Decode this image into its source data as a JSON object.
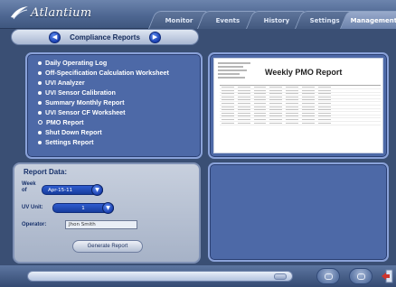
{
  "app": {
    "logo_text": "Atlantium"
  },
  "tabs": [
    {
      "label": "Monitor",
      "active": false
    },
    {
      "label": "Events",
      "active": false
    },
    {
      "label": "History",
      "active": false
    },
    {
      "label": "Settings",
      "active": false
    },
    {
      "label": "Management",
      "active": true
    }
  ],
  "compliance": {
    "title": "Compliance Reports"
  },
  "reports": [
    {
      "label": "Daily Operating Log",
      "selected": false
    },
    {
      "label": "Off-Specification Calculation Worksheet",
      "selected": false
    },
    {
      "label": "UVI Analyzer",
      "selected": false
    },
    {
      "label": "UVI Sensor Calibration",
      "selected": false
    },
    {
      "label": "Summary Monthly Report",
      "selected": false
    },
    {
      "label": "UVI Sensor CF Worksheet",
      "selected": false
    },
    {
      "label": "PMO Report",
      "selected": true
    },
    {
      "label": "Shut Down Report",
      "selected": false
    },
    {
      "label": "Settings Report",
      "selected": false
    }
  ],
  "preview": {
    "title": "Weekly PMO Report"
  },
  "report_data": {
    "title": "Report Data:",
    "week_label": "Week of",
    "week_value": "Apr-15-11",
    "uv_unit_label": "UV Unit:",
    "uv_unit_value": "1",
    "operator_label": "Operator:",
    "operator_value": "Jhon Smith",
    "generate_label": "Generate Report"
  },
  "colors": {
    "panel": "#4d69a7",
    "panel_border": "#8aa2d9",
    "accent_button": "#1a3fb0"
  }
}
